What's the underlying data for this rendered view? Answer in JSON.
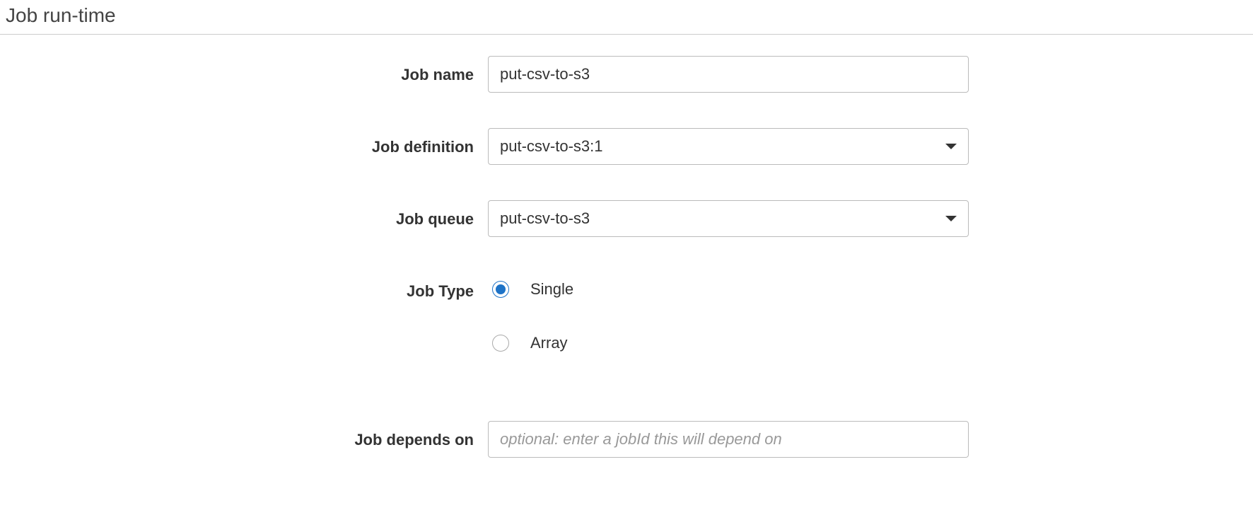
{
  "section": {
    "title": "Job run-time"
  },
  "form": {
    "jobName": {
      "label": "Job name",
      "value": "put-csv-to-s3"
    },
    "jobDefinition": {
      "label": "Job definition",
      "value": "put-csv-to-s3:1"
    },
    "jobQueue": {
      "label": "Job queue",
      "value": "put-csv-to-s3"
    },
    "jobType": {
      "label": "Job Type",
      "options": {
        "single": "Single",
        "array": "Array"
      },
      "selected": "single"
    },
    "jobDependsOn": {
      "label": "Job depends on",
      "value": "",
      "placeholder": "optional: enter a jobId this will depend on"
    }
  }
}
